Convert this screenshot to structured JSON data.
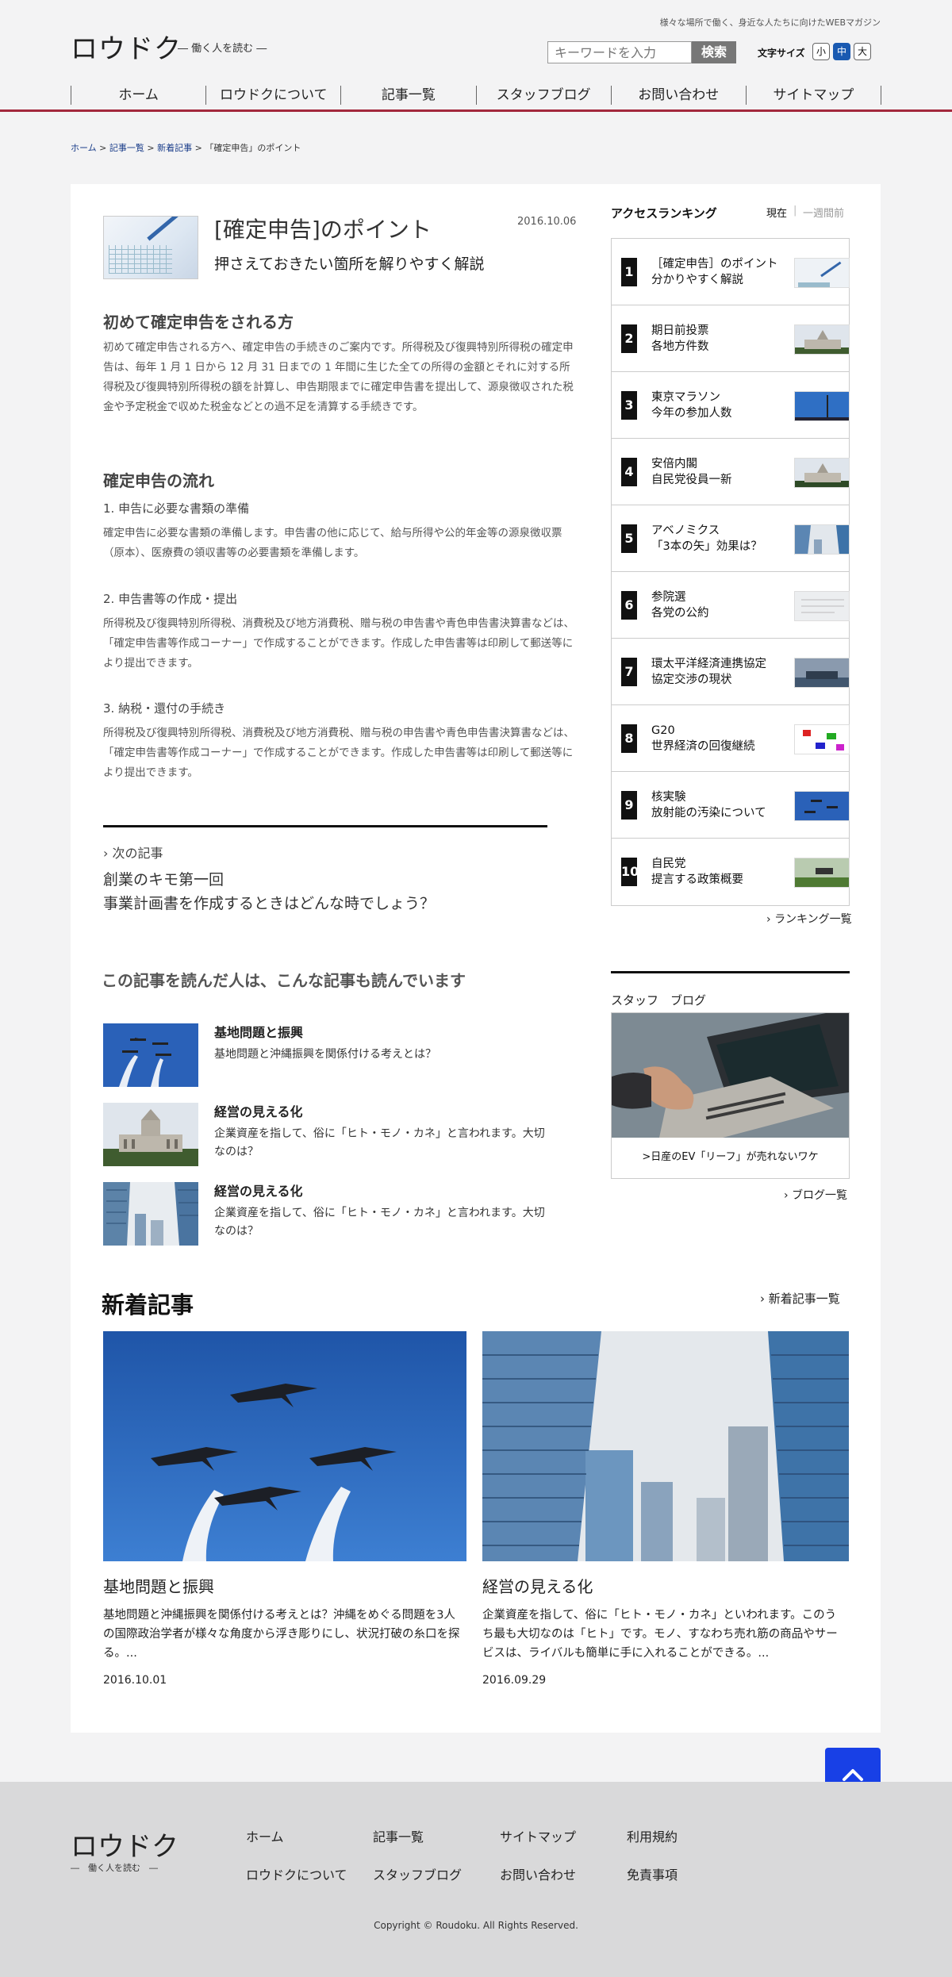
{
  "header": {
    "logo": "ロウドク",
    "tagline": "― 働く人を読む ―",
    "copy": "様々な場所で働く、身近な人たちに向けたWEBマガジン",
    "search_placeholder": "キーワードを入力",
    "search_button": "検索",
    "font_size_label": "文字サイズ",
    "font_sizes": [
      "小",
      "中",
      "大"
    ],
    "nav": [
      "ホーム",
      "ロウドクについて",
      "記事一覧",
      "スタッフブログ",
      "お問い合わせ",
      "サイトマップ"
    ]
  },
  "breadcrumb": {
    "home": "ホーム",
    "sep": " > ",
    "list": "記事一覧",
    "new": "新着記事",
    "current": "「確定申告」のポイント"
  },
  "article": {
    "title": "[確定申告]のポイント",
    "date": "2016.10.06",
    "subtitle": "押さえておきたい箇所を解りやすく解説",
    "sec1_heading": "初めて確定申告をされる方",
    "sec1_body": "初めて確定申告される方へ、確定申告の手続きのご案内です。所得税及び復興特別所得税の確定申告は、毎年 1 月 1 日から 12 月 31 日までの 1 年間に生じた全ての所得の金額とそれに対する所得税及び復興特別所得税の額を計算し、申告期限までに確定申告書を提出して、源泉徴収された税金や予定税金で収めた税金などとの過不足を清算する手続きです。",
    "sec2_heading": "確定申告の流れ",
    "step1_heading": "1. 申告に必要な書類の準備",
    "step1_body": "確定申告に必要な書類の準備します。申告書の他に応じて、給与所得や公的年金等の源泉徴収票（原本）、医療費の領収書等の必要書類を準備します。",
    "step2_heading": "2. 申告書等の作成・提出",
    "step2_body": "所得税及び復興特別所得税、消費税及び地方消費税、贈与税の申告書や青色申告書決算書などは、「確定申告書等作成コーナー」で作成することができます。作成した申告書等は印刷して郵送等により提出できます。",
    "step3_heading": "3. 納税・還付の手続き",
    "step3_body": "所得税及び復興特別所得税、消費税及び地方消費税、贈与税の申告書や青色申告書決算書などは、「確定申告書等作成コーナー」で作成することができます。作成した申告書等は印刷して郵送等により提出できます。",
    "next_label": "次の記事",
    "next_title_1": "創業のキモ第一回",
    "next_title_2": "事業計画書を作成するときはどんな時でしょう？"
  },
  "related": {
    "heading": "この記事を読んだ人は、こんな記事も読んでいます",
    "items": [
      {
        "title": "基地問題と振興",
        "desc": "基地問題と沖縄振興を関係付ける考えとは？"
      },
      {
        "title": "経営の見える化",
        "desc": "企業資産を指して、俗に「ヒト・モノ・カネ」と言われます。大切なのは？"
      },
      {
        "title": "経営の見える化",
        "desc": "企業資産を指して、俗に「ヒト・モノ・カネ」と言われます。大切なのは？"
      }
    ]
  },
  "new_articles": {
    "heading": "新着記事",
    "all_link": "新着記事一覧",
    "cards": [
      {
        "title": "基地問題と振興",
        "desc": "基地問題と沖縄振興を関係付ける考えとは？沖縄をめぐる問題を3人の国際政治学者が様々な角度から浮き彫りにし、状況打破の糸口を探る。...",
        "date": "2016.10.01"
      },
      {
        "title": "経営の見える化",
        "desc": "企業資産を指して、俗に「ヒト・モノ・カネ」といわれます。このうち最も大切なのは「ヒト」です。モノ、すなわち売れ筋の商品やサービスは、ライバルも簡単に手に入れることができる。...",
        "date": "2016.09.29"
      }
    ]
  },
  "ranking": {
    "heading": "アクセスランキング",
    "tab_now": "現在",
    "tab_sep": "|",
    "tab_week": "一週間前",
    "items": [
      {
        "num": "1",
        "line1": "［確定申告］のポイント",
        "line2": "分かりやすく解説"
      },
      {
        "num": "2",
        "line1": "期日前投票",
        "line2": "各地方件数"
      },
      {
        "num": "3",
        "line1": "東京マラソン",
        "line2": "今年の参加人数"
      },
      {
        "num": "4",
        "line1": "安倍内閣",
        "line2": "自民党役員一新"
      },
      {
        "num": "5",
        "line1": "アベノミクス",
        "line2": "「3本の矢」効果は？"
      },
      {
        "num": "6",
        "line1": "参院選",
        "line2": "各党の公約"
      },
      {
        "num": "7",
        "line1": "環太平洋経済連携協定",
        "line2": "協定交渉の現状"
      },
      {
        "num": "8",
        "line1": "G20",
        "line2": "世界経済の回復継続"
      },
      {
        "num": "9",
        "line1": "核実験",
        "line2": "放射能の汚染について"
      },
      {
        "num": "10",
        "line1": "自民党",
        "line2": "提言する政策概要"
      }
    ],
    "all_link": "ランキング一覧"
  },
  "blog": {
    "heading": "スタッフ　ブログ",
    "caption": ">日産のEV「リーフ」が売れないワケ",
    "all_link": "ブログ一覧"
  },
  "footer": {
    "logo": "ロウドク",
    "tagline": "―　働く人を読む　―",
    "links": [
      "ホーム",
      "記事一覧",
      "サイトマップ",
      "利用規約",
      "ロウドクについて",
      "スタッフブログ",
      "お問い合わせ",
      "免責事項"
    ],
    "copyright": "Copyright © Roudoku. All Rights Reserved."
  },
  "colors": {
    "accent_red": "#a3283c",
    "font_active": "#1a5ab1",
    "pagetop_blue": "#1840e6"
  },
  "icons": [
    "chevron-right-icon",
    "arrow-up-icon"
  ]
}
